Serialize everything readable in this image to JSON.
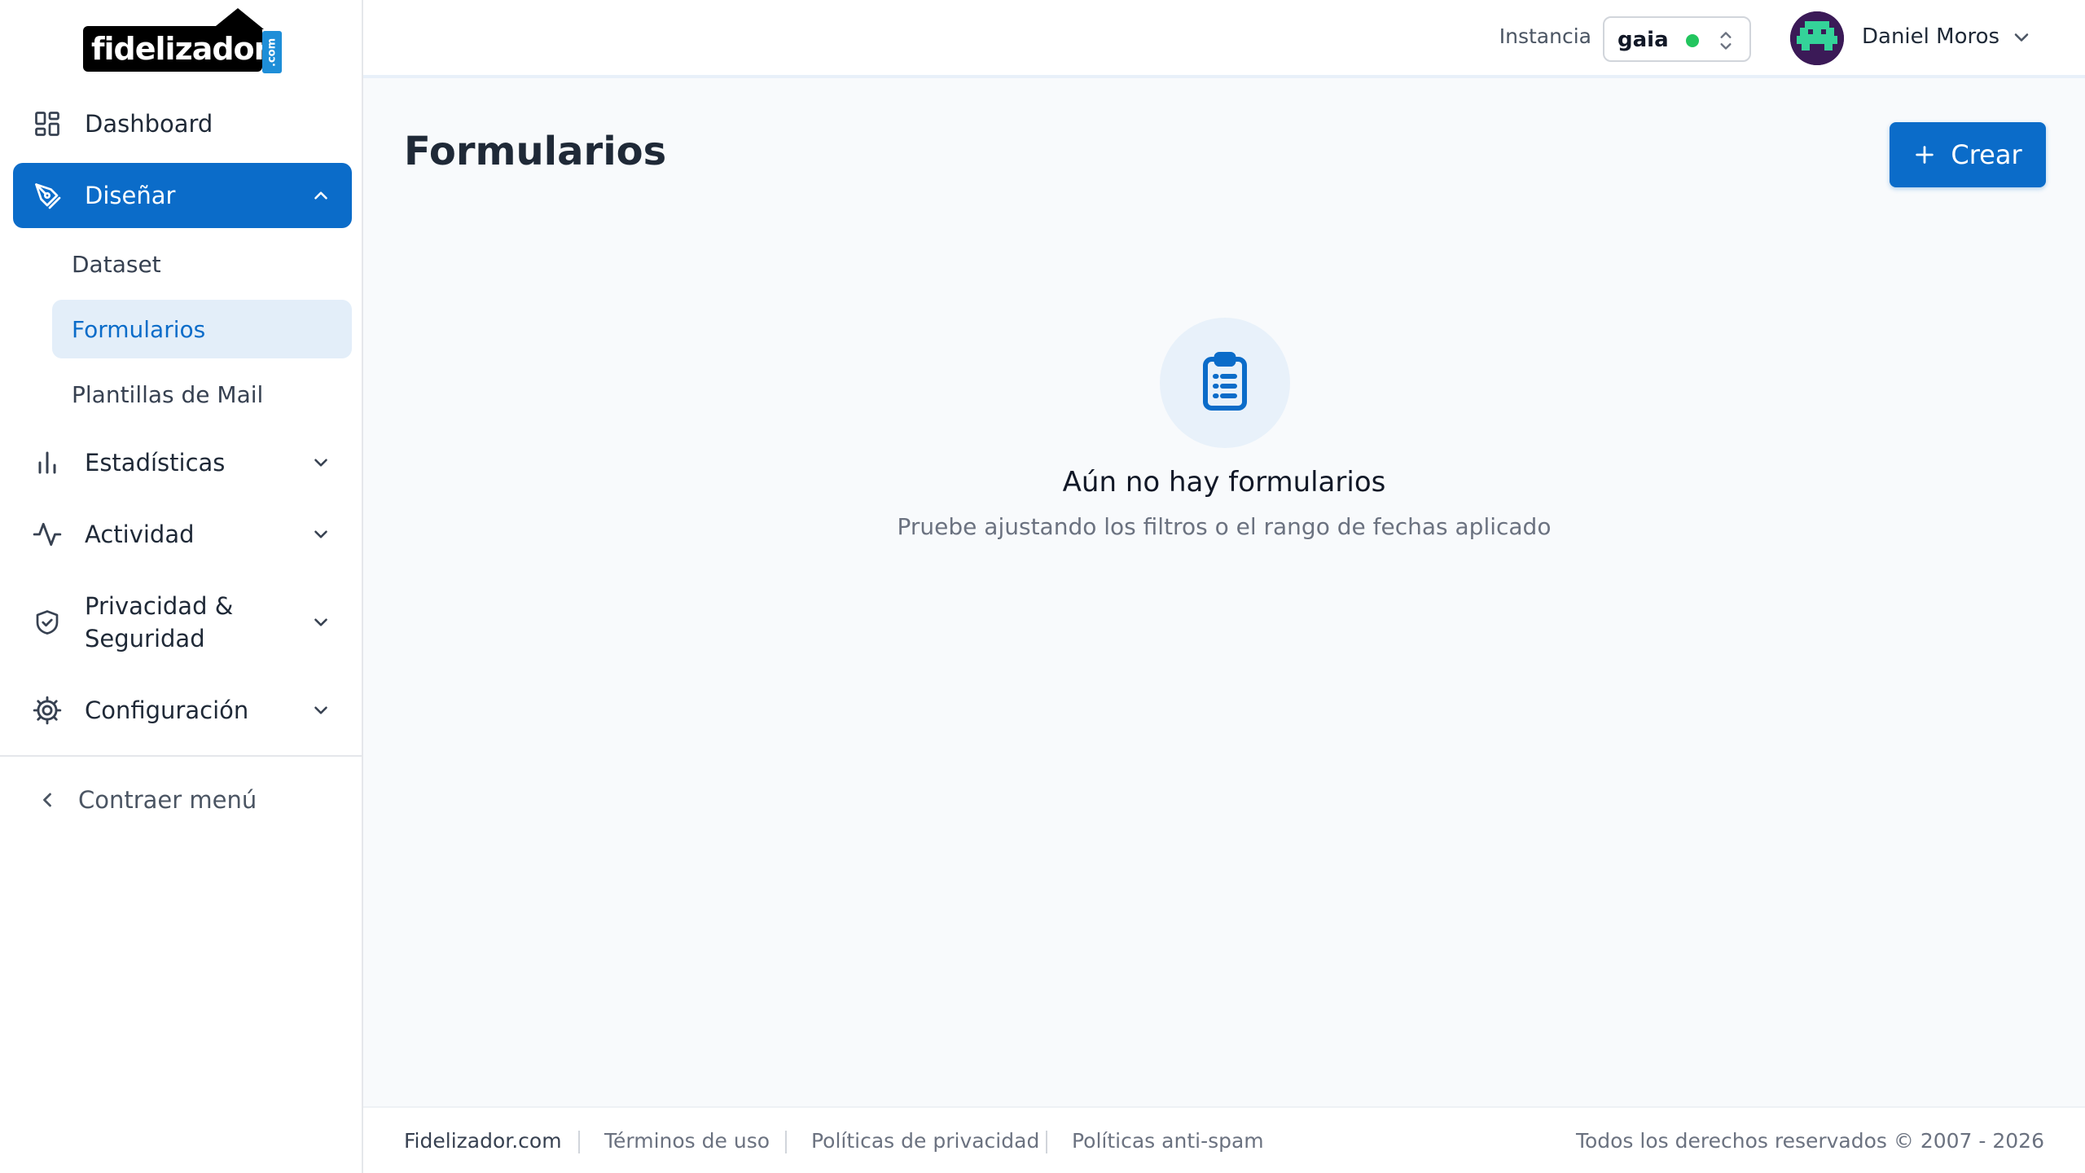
{
  "brand": {
    "logo_text": "fidelizador",
    "logo_suffix": ".com"
  },
  "topbar": {
    "instance_label": "Instancia",
    "instance_value": "gaia",
    "instance_status_color": "#22c55e",
    "user_name": "Daniel Moros"
  },
  "sidebar": {
    "dashboard": "Dashboard",
    "design": "Diseñar",
    "design_sub": [
      "Dataset",
      "Formularios",
      "Plantillas de Mail"
    ],
    "stats": "Estadísticas",
    "activity": "Actividad",
    "privacy_line1": "Privacidad &",
    "privacy_line2": "Seguridad",
    "config": "Configuración",
    "collapse": "Contraer menú"
  },
  "main": {
    "title": "Formularios",
    "create_button": "Crear",
    "empty_title": "Aún no hay formularios",
    "empty_subtitle": "Pruebe ajustando los filtros o el rango de fechas aplicado"
  },
  "footer": {
    "brand": "Fidelizador.com",
    "links": [
      "Términos de uso",
      "Políticas de privacidad",
      "Políticas anti-spam"
    ],
    "copyright": "Todos los derechos reservados © 2007 - 2026"
  },
  "colors": {
    "accent": "#0b6cc9",
    "active_sub_bg": "#e3eef9"
  }
}
